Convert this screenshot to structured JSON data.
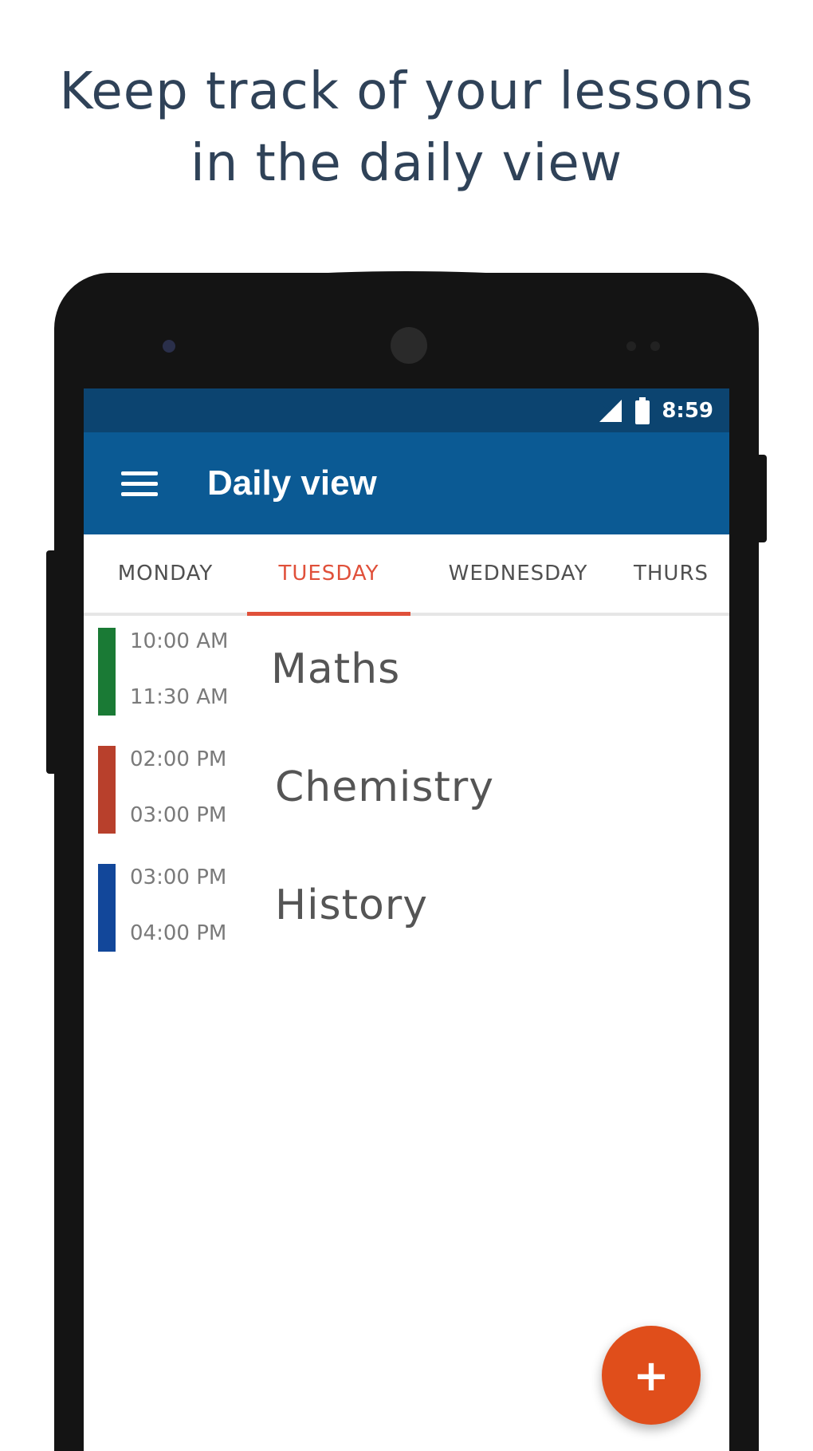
{
  "headline": {
    "line1": "Keep track of your lessons",
    "line2": "in the daily view"
  },
  "status_bar": {
    "time": "8:59",
    "icons": [
      "signal-icon",
      "battery-icon"
    ]
  },
  "app_bar": {
    "title": "Daily view",
    "menu_icon": "hamburger-menu-icon"
  },
  "tabs": [
    {
      "label": "MONDAY"
    },
    {
      "label": "TUESDAY"
    },
    {
      "label": "WEDNESDAY"
    },
    {
      "label": "THURS"
    }
  ],
  "active_tab": "TUESDAY",
  "lessons": [
    {
      "start": "10:00 AM",
      "end": "11:30 AM",
      "subject": "Maths",
      "color": "#1a7a35"
    },
    {
      "start": "02:00 PM",
      "end": "03:00 PM",
      "subject": "Chemistry",
      "color": "#b8402c"
    },
    {
      "start": "03:00 PM",
      "end": "04:00 PM",
      "subject": "History",
      "color": "#12479a"
    }
  ],
  "fab": {
    "label": "+"
  },
  "colors": {
    "primary": "#0b5a94",
    "primary_dark": "#0c4470",
    "accent": "#e04e1b",
    "tab_active": "#e0503a"
  }
}
